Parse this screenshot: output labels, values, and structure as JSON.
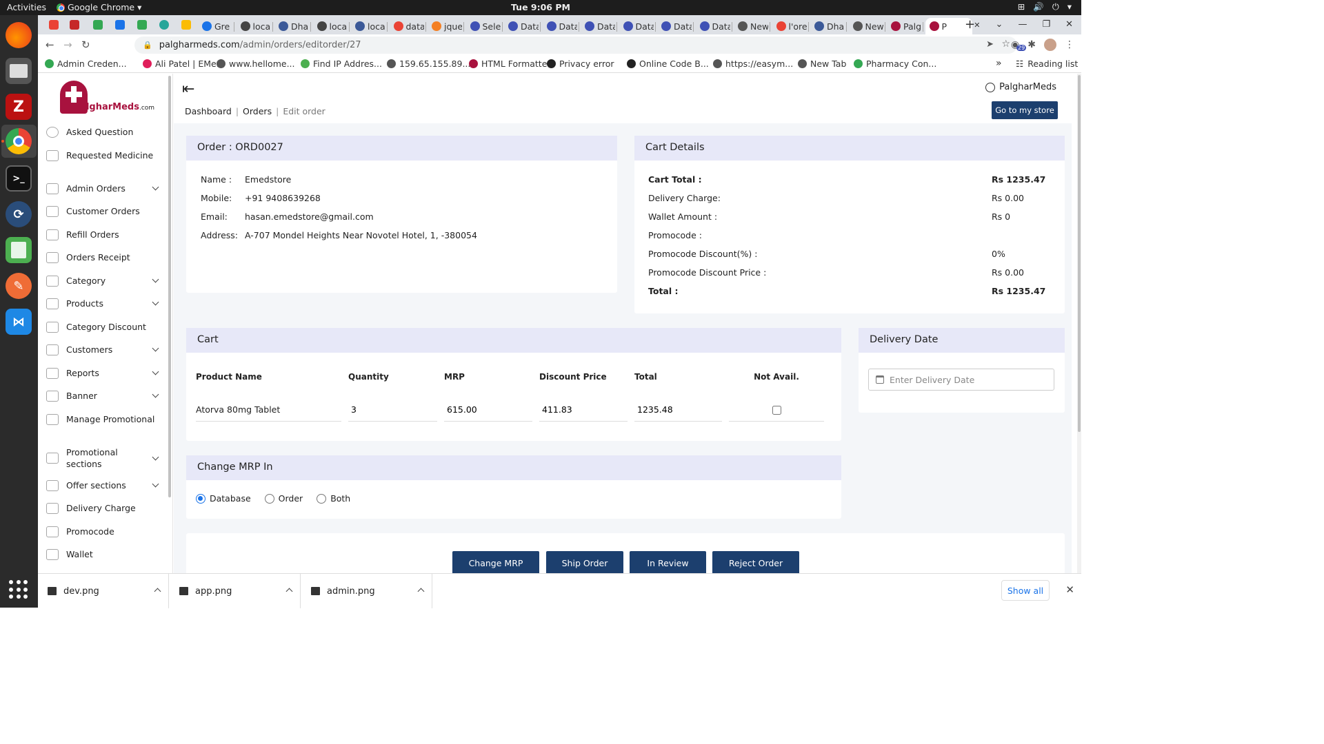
{
  "os": {
    "activities": "Activities",
    "app_name": "Google Chrome",
    "clock": "Tue  9:06 PM"
  },
  "browser": {
    "tabs": [
      {
        "label": "Gre",
        "color": "#1a73e8"
      },
      {
        "label": "loca",
        "color": "#444444"
      },
      {
        "label": "Dha",
        "color": "#3b5998"
      },
      {
        "label": "loca",
        "color": "#444444"
      },
      {
        "label": "loca",
        "color": "#3b5998"
      },
      {
        "label": "data",
        "color": "#ea4335"
      },
      {
        "label": "jque",
        "color": "#f48024"
      },
      {
        "label": "Sele",
        "color": "#3f51b5"
      },
      {
        "label": "Data",
        "color": "#3f51b5"
      },
      {
        "label": "Data",
        "color": "#3f51b5"
      },
      {
        "label": "Data",
        "color": "#3f51b5"
      },
      {
        "label": "Data",
        "color": "#3f51b5"
      },
      {
        "label": "Data",
        "color": "#3f51b5"
      },
      {
        "label": "Data",
        "color": "#3f51b5"
      },
      {
        "label": "New",
        "color": "#555555"
      },
      {
        "label": "l'ore",
        "color": "#ea4335"
      },
      {
        "label": "Dha",
        "color": "#3b5998"
      },
      {
        "label": "New",
        "color": "#555555"
      },
      {
        "label": "Palg",
        "color": "#a8123e"
      },
      {
        "label": "P",
        "color": "#a8123e"
      }
    ],
    "url_host": "palgharmeds.com",
    "url_path": "/admin/orders/editorder/27",
    "extension_badge": "29",
    "bookmarks": [
      "Admin Creden...",
      "Ali Patel | EMe...",
      "www.hellome...",
      "Find IP Addres...",
      "159.65.155.89...",
      "HTML Formatter",
      "Privacy error",
      "Online Code B...",
      "https://easym...",
      "New Tab",
      "Pharmacy Con..."
    ],
    "bookmarks_more": "»",
    "reading_list": "Reading list"
  },
  "sidebar": {
    "logo_brand": "PalgharMeds",
    "logo_suffix": ".com",
    "items": [
      {
        "label": "Asked Question",
        "dropdown": false
      },
      {
        "label": "Requested Medicine",
        "dropdown": false
      },
      {
        "label": "Admin Orders",
        "dropdown": true
      },
      {
        "label": "Customer Orders",
        "dropdown": false
      },
      {
        "label": "Refill Orders",
        "dropdown": false
      },
      {
        "label": "Orders Receipt",
        "dropdown": false
      },
      {
        "label": "Category",
        "dropdown": true
      },
      {
        "label": "Products",
        "dropdown": true
      },
      {
        "label": "Category Discount",
        "dropdown": false
      },
      {
        "label": "Customers",
        "dropdown": true
      },
      {
        "label": "Reports",
        "dropdown": true
      },
      {
        "label": "Banner",
        "dropdown": true
      },
      {
        "label": "Manage Promotional",
        "dropdown": false
      },
      {
        "label": "Promotional sections",
        "dropdown": true
      },
      {
        "label": "Offer sections",
        "dropdown": true
      },
      {
        "label": "Delivery Charge",
        "dropdown": false
      },
      {
        "label": "Promocode",
        "dropdown": false
      },
      {
        "label": "Wallet",
        "dropdown": false
      }
    ]
  },
  "header": {
    "collapse_icon": "⇤",
    "breadcrumb": [
      "Dashboard",
      "Orders",
      "Edit order"
    ],
    "user_name": "PalgharMeds",
    "store_button": "Go to my store"
  },
  "order": {
    "title": "Order : ORD0027",
    "fields": [
      {
        "label": "Name :",
        "value": "Emedstore"
      },
      {
        "label": "Mobile:",
        "value": "+91 9408639268"
      },
      {
        "label": "Email:",
        "value": "hasan.emedstore@gmail.com"
      },
      {
        "label": "Address:",
        "value": "A-707 Mondel Heights Near Novotel Hotel, 1, -380054"
      }
    ]
  },
  "cart_details": {
    "title": "Cart Details",
    "rows": [
      {
        "label": "Cart Total :",
        "value": "Rs 1235.47",
        "bold": true
      },
      {
        "label": "Delivery Charge:",
        "value": "Rs 0.00",
        "bold": false
      },
      {
        "label": "Wallet Amount :",
        "value": "Rs 0",
        "bold": false
      },
      {
        "label": "Promocode :",
        "value": "",
        "bold": false
      },
      {
        "label": "Promocode Discount(%) :",
        "value": "0%",
        "bold": false
      },
      {
        "label": "Promocode Discount Price :",
        "value": "Rs 0.00",
        "bold": false
      },
      {
        "label": "Total :",
        "value": "Rs 1235.47",
        "bold": true
      }
    ]
  },
  "cart": {
    "title": "Cart",
    "columns": [
      "Product Name",
      "Quantity",
      "MRP",
      "Discount Price",
      "Total",
      "Not Avail."
    ],
    "rows": [
      {
        "product": "Atorva 80mg Tablet",
        "quantity": "3",
        "mrp": "615.00",
        "discount_price": "411.83",
        "total": "1235.48",
        "not_available": false
      }
    ]
  },
  "delivery": {
    "title": "Delivery Date",
    "placeholder": "Enter Delivery Date"
  },
  "change_mrp": {
    "title": "Change MRP In",
    "options": [
      "Database",
      "Order",
      "Both"
    ],
    "selected": "Database"
  },
  "actions": [
    "Change MRP",
    "Ship Order",
    "In Review",
    "Reject Order"
  ],
  "downloads": {
    "files": [
      "dev.png",
      "app.png",
      "admin.png"
    ],
    "show_all": "Show all"
  }
}
